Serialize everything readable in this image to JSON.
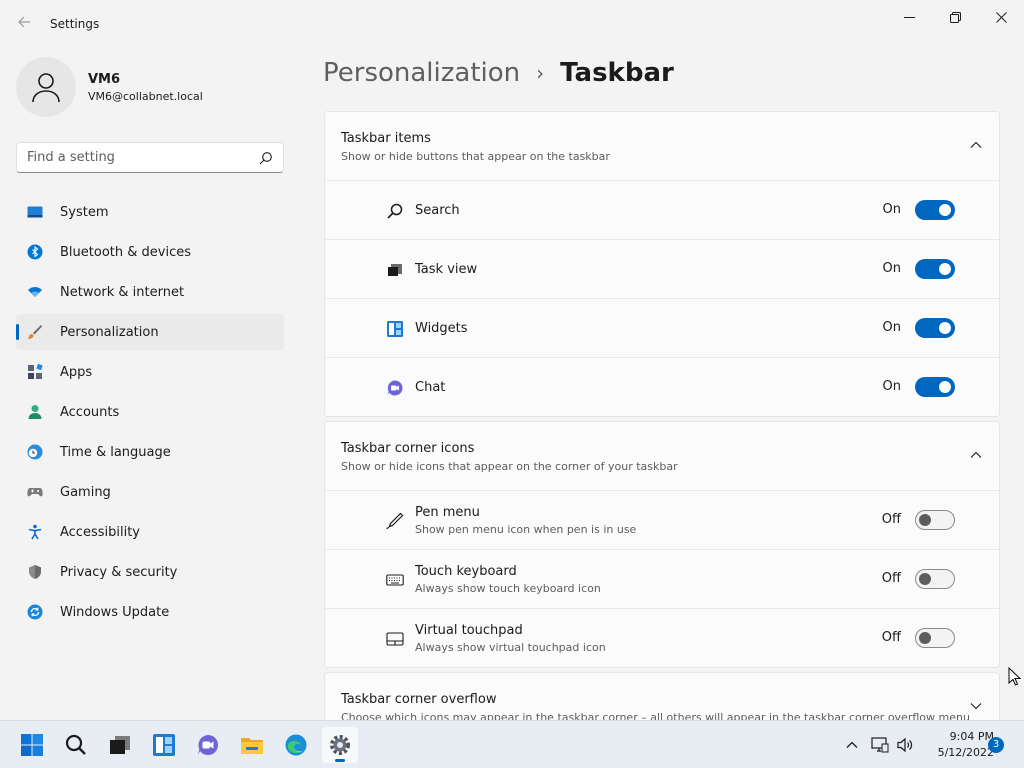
{
  "window": {
    "title": "Settings",
    "back_icon": "arrow-left-icon",
    "controls": [
      "minimize-icon",
      "restore-icon",
      "close-icon"
    ]
  },
  "profile": {
    "name": "VM6",
    "email": "VM6@collabnet.local"
  },
  "search": {
    "placeholder": "Find a setting"
  },
  "nav": {
    "items": [
      {
        "label": "System",
        "icon": "system-icon",
        "color": "#0078d4"
      },
      {
        "label": "Bluetooth & devices",
        "icon": "bluetooth-icon",
        "color": "#0078d4"
      },
      {
        "label": "Network & internet",
        "icon": "wifi-icon",
        "color": "#0078d4"
      },
      {
        "label": "Personalization",
        "icon": "brush-icon",
        "color": "#e0823d"
      },
      {
        "label": "Apps",
        "icon": "apps-icon",
        "color": "#505b6b"
      },
      {
        "label": "Accounts",
        "icon": "person-icon",
        "color": "#2bb07f"
      },
      {
        "label": "Time & language",
        "icon": "clock-globe-icon",
        "color": "#0078d4"
      },
      {
        "label": "Gaming",
        "icon": "gamepad-icon",
        "color": "#6b6b6b"
      },
      {
        "label": "Accessibility",
        "icon": "accessibility-icon",
        "color": "#0b6bcb"
      },
      {
        "label": "Privacy & security",
        "icon": "shield-icon",
        "color": "#7a7a7a"
      },
      {
        "label": "Windows Update",
        "icon": "update-icon",
        "color": "#0078d4"
      }
    ],
    "active_index": 3
  },
  "breadcrumb": {
    "parent": "Personalization",
    "separator": "›",
    "current": "Taskbar"
  },
  "groups": [
    {
      "title": "Taskbar items",
      "desc": "Show or hide buttons that appear on the taskbar",
      "expanded": true,
      "rows": [
        {
          "label": "Search",
          "state": "On",
          "on": true,
          "icon": "search-icon"
        },
        {
          "label": "Task view",
          "state": "On",
          "on": true,
          "icon": "task-view-icon"
        },
        {
          "label": "Widgets",
          "state": "On",
          "on": true,
          "icon": "widgets-icon"
        },
        {
          "label": "Chat",
          "state": "On",
          "on": true,
          "icon": "chat-icon"
        }
      ]
    },
    {
      "title": "Taskbar corner icons",
      "desc": "Show or hide icons that appear on the corner of your taskbar",
      "expanded": true,
      "rows": [
        {
          "label": "Pen menu",
          "desc": "Show pen menu icon when pen is in use",
          "state": "Off",
          "on": false,
          "icon": "pen-icon"
        },
        {
          "label": "Touch keyboard",
          "desc": "Always show touch keyboard icon",
          "state": "Off",
          "on": false,
          "icon": "keyboard-icon"
        },
        {
          "label": "Virtual touchpad",
          "desc": "Always show virtual touchpad icon",
          "state": "Off",
          "on": false,
          "icon": "touchpad-icon"
        }
      ]
    },
    {
      "title": "Taskbar corner overflow",
      "desc": "Choose which icons may appear in the taskbar corner – all others will appear in the taskbar corner overflow menu",
      "expanded": false,
      "rows": []
    }
  ],
  "taskbar": {
    "apps": [
      "start-icon",
      "search-icon",
      "task-view-icon",
      "widgets-icon",
      "chat-icon",
      "file-explorer-icon",
      "edge-icon",
      "settings-icon"
    ],
    "active_app": "settings-icon",
    "tray_icons": [
      "chevron-up-icon",
      "network-icon",
      "volume-icon"
    ],
    "time": "9:04 PM",
    "date": "5/12/2022",
    "notification_count": "3"
  },
  "colors": {
    "accent": "#0067c0",
    "background": "#f3f3f3",
    "card": "#fbfbfb"
  }
}
